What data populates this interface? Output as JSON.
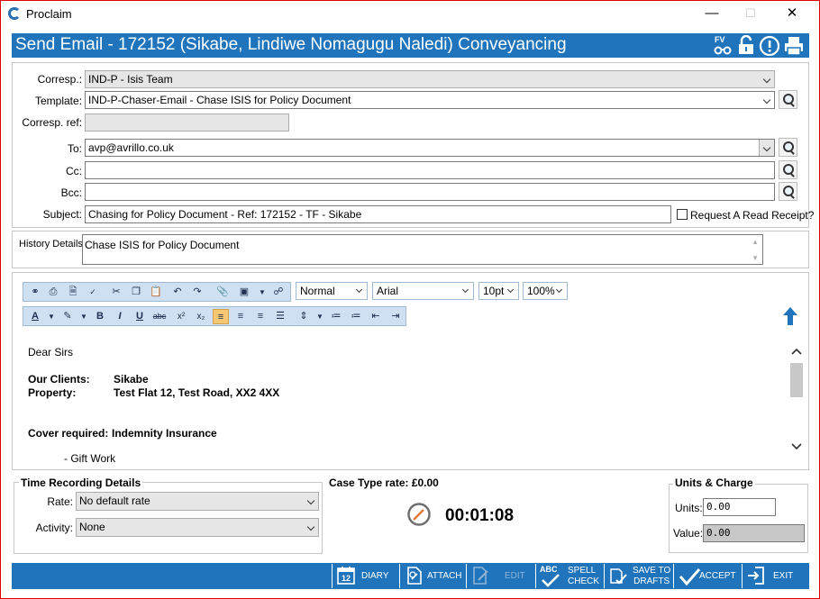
{
  "window": {
    "app_title": "Proclaim",
    "minimize": "—",
    "maximize": "☐",
    "close": "✕"
  },
  "header": {
    "title": "Send Email - 172152 (Sikabe, Lindiwe Nomagugu Naledi) Conveyancing",
    "fv_label": "FV"
  },
  "form": {
    "corresp_label": "Corresp.:",
    "corresp_value": "IND-P - Isis Team",
    "template_label": "Template:",
    "template_value": "IND-P-Chaser-Email - Chase ISIS for Policy Document",
    "corresp_ref_label": "Corresp. ref:",
    "corresp_ref_value": "",
    "to_label": "To:",
    "to_value": "avp@avrillo.co.uk",
    "cc_label": "Cc:",
    "cc_value": "",
    "bcc_label": "Bcc:",
    "bcc_value": "",
    "subject_label": "Subject:",
    "subject_value": "Chasing for Policy Document - Ref: 172152 - TF - Sikabe",
    "read_receipt_label": "Request A Read Receipt?",
    "read_receipt_checked": false,
    "history_label": "History Details:",
    "history_value": "Chase ISIS for Policy Document"
  },
  "editor": {
    "style_value": "Normal",
    "font_value": "Arial",
    "size_value": "10pt",
    "zoom_value": "100%",
    "body": {
      "greeting": "Dear Sirs",
      "clients_label": "Our Clients:",
      "clients_value": "Sikabe",
      "property_label": "Property:",
      "property_value": "Test Flat 12, Test Road, XX2 4XX",
      "cover_label": "Cover required:",
      "cover_value": "Indemnity Insurance",
      "gift_line": "- Gift Work"
    }
  },
  "time_recording": {
    "title": "Time Recording Details",
    "rate_label": "Rate:",
    "rate_value": "No default rate",
    "activity_label": "Activity:",
    "activity_value": "None"
  },
  "case_type": {
    "rate_text": "Case Type rate: £0.00",
    "timer": "00:01:08"
  },
  "units_charge": {
    "title": "Units & Charge",
    "units_label": "Units:",
    "units_value": "0.00",
    "value_label": "Value:",
    "value_value": "0.00"
  },
  "footer": {
    "diary": "DIARY",
    "attach": "ATTACH",
    "edit": "EDIT",
    "spell_1": "SPELL",
    "spell_2": "CHECK",
    "abc": "ABC",
    "drafts_1": "SAVE TO",
    "drafts_2": "DRAFTS",
    "accept": "ACCEPT",
    "exit": "EXIT",
    "calendar_day": "12"
  },
  "colors": {
    "header_blue": "#1f74bb",
    "toolbar_blue": "#cfe0f2",
    "frame_red": "#e00000"
  }
}
